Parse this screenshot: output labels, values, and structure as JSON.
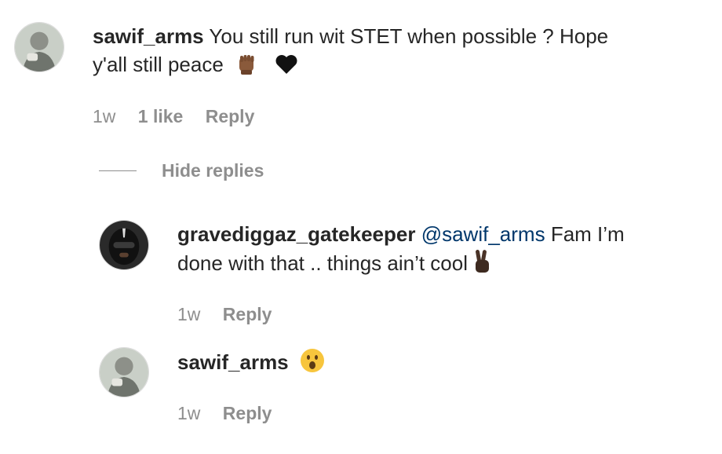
{
  "comments": [
    {
      "username": "sawif_arms",
      "text": "You still run wit STET when possible ? Hope",
      "text_line2": "y'all still peace",
      "emojis": [
        "raised-fist-emoji",
        "black-heart-emoji"
      ],
      "time": "1w",
      "likes": "1 like",
      "reply_label": "Reply"
    }
  ],
  "hide_replies_label": "Hide replies",
  "replies": [
    {
      "username": "gravediggaz_gatekeeper",
      "mention": "@sawif_arms",
      "text": "Fam I’m",
      "text_line2": "done with that .. things ain’t cool",
      "emojis": [
        "victory-hand-emoji"
      ],
      "time": "1w",
      "reply_label": "Reply"
    },
    {
      "username": "sawif_arms",
      "text": "",
      "emojis": [
        "surprised-face-emoji"
      ],
      "time": "1w",
      "reply_label": "Reply"
    }
  ],
  "colors": {
    "text": "#262626",
    "secondary": "#8e8e8e",
    "mention": "#00376b"
  }
}
